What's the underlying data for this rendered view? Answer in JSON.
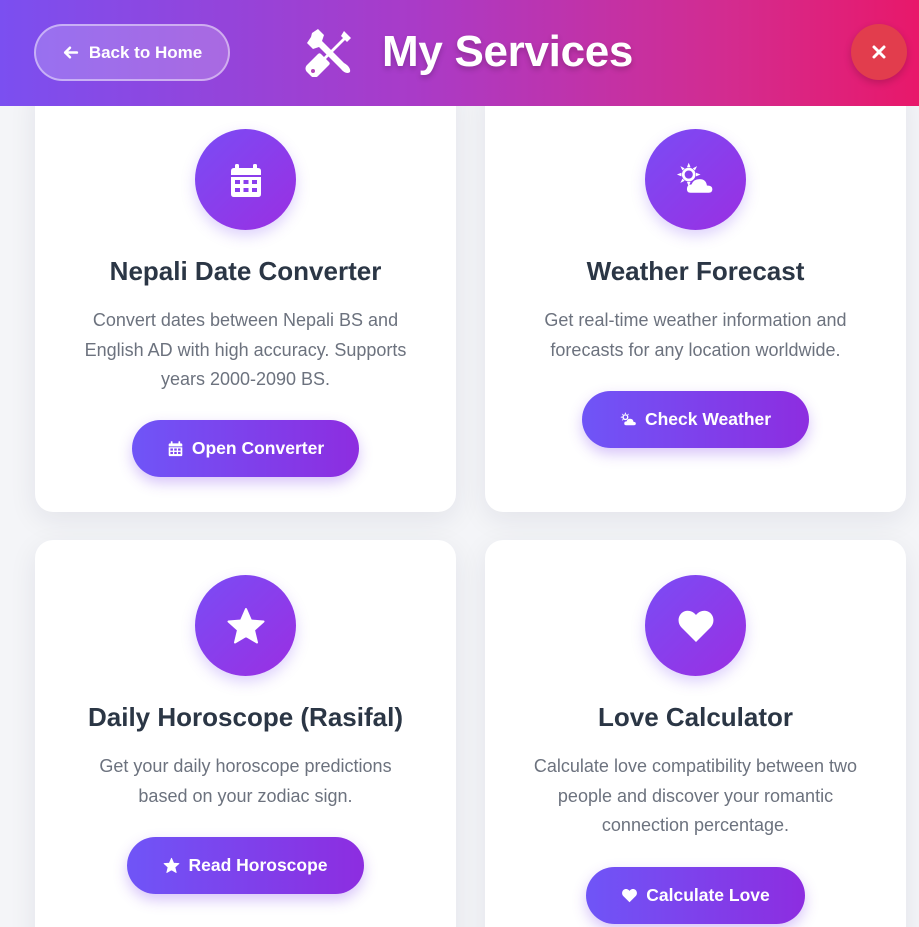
{
  "header": {
    "back_label": "Back to Home",
    "title": "My Services",
    "title_icon": "tools-icon",
    "close_icon": "close-icon",
    "gradient_colors": [
      "#7b4ff0",
      "#a93bc8",
      "#d42b8e",
      "#e8186a"
    ]
  },
  "services": [
    {
      "icon": "calendar-icon",
      "title": "Nepali Date Converter",
      "description": "Convert dates between Nepali BS and English AD with high accuracy. Supports years 2000-2090 BS.",
      "button_label": "Open Converter"
    },
    {
      "icon": "weather-sun-cloud-icon",
      "title": "Weather Forecast",
      "description": "Get real-time weather information and forecasts for any location worldwide.",
      "button_label": "Check Weather"
    },
    {
      "icon": "star-icon",
      "title": "Daily Horoscope (Rasifal)",
      "description": "Get your daily horoscope predictions based on your zodiac sign.",
      "button_label": "Read Horoscope"
    },
    {
      "icon": "heart-icon",
      "title": "Love Calculator",
      "description": "Calculate love compatibility between two people and discover your romantic connection percentage.",
      "button_label": "Calculate Love"
    }
  ],
  "colors": {
    "accent_purple": "#7a4cf5",
    "accent_violet": "#9a2fe2",
    "close_red": "#e23d4d",
    "title_text": "#2b3645",
    "body_text": "#6c727e"
  }
}
